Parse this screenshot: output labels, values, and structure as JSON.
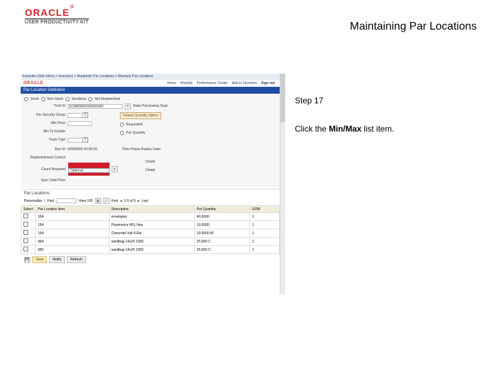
{
  "brand": {
    "logo": "ORACLE",
    "product": "USER PRODUCTIVITY KIT"
  },
  "page_title": "Maintaining Par Locations",
  "instruction": {
    "step_label": "Step 17",
    "text_prefix": "Click the ",
    "bold": "Min/Max",
    "text_suffix": " list item."
  },
  "shot": {
    "menubar": "Favorites    Main Menu > Inventory > Replenish Par Locations > Maintain Par Locations",
    "orbar": {
      "logo": "ORACLE",
      "tabs": {
        "home": "Home",
        "worklist": "Worklist",
        "perf": "Performance Center",
        "addfav": "Add to Favorites",
        "signout": "Sign out"
      }
    },
    "hdr": "Par Location Definition",
    "opts": {
      "stock": "Stock",
      "nonstock": "Non-Stock",
      "stockless": "Stockless",
      "notreplenished": "Not Replenished"
    },
    "unit": {
      "label": "Unit ID",
      "value": "SCM00000000000000",
      "hint": "State Purchasing Dept"
    },
    "rows": {
      "par_security": "Par Security Group",
      "min_price": "Min Price",
      "min_to_include": "Min To Include",
      "track_type": "Track Type",
      "run_id": "Run ID",
      "run_val": "0/00/0000 00:00:00",
      "time_phase": "Time Phase Replen Date:",
      "repl_ctrl": "Replenishment Control",
      "count_req": "Count Required",
      "opt_dropdown": "Optional",
      "syncdt": "Sync Date/Time"
    },
    "quantity_box": {
      "title": "Default Quantity Option",
      "opt1": "Requested",
      "opt2": "Par Quantity"
    },
    "dropdown_list": {
      "onsite": "Onsite",
      "usage": "Usage"
    },
    "section": {
      "title": "Par Locations",
      "find": "Find",
      "view": "View 100",
      "pager_first": "First",
      "pager_last": "Last",
      "pager_range": "1-5 of 5",
      "personalize": "Personalize"
    },
    "table": {
      "cols": {
        "sel": "Select",
        "item": "Par Location Item",
        "desc": "Description",
        "par": "Par Quantity",
        "uom": "UOM"
      },
      "rows": [
        {
          "item": "104",
          "desc": "envelopes",
          "par": "40.0000",
          "uom": "1"
        },
        {
          "item": "154",
          "desc": "Plantronics H51 Hea",
          "par": "10.0000",
          "uom": "1"
        },
        {
          "item": "154",
          "desc": "Chevrolet Volt 4 Ele",
          "par": "10.0000 W",
          "uom": "1"
        },
        {
          "item": "d94",
          "desc": "sandbag 14x26 1000",
          "par": "25.000 C",
          "uom": "1"
        },
        {
          "item": "d90",
          "desc": "sandbag 14x26 1000",
          "par": "25.000 C",
          "uom": "1"
        }
      ]
    },
    "footer": {
      "save": "Save",
      "notify": "Notify",
      "refresh": "Refresh"
    }
  }
}
